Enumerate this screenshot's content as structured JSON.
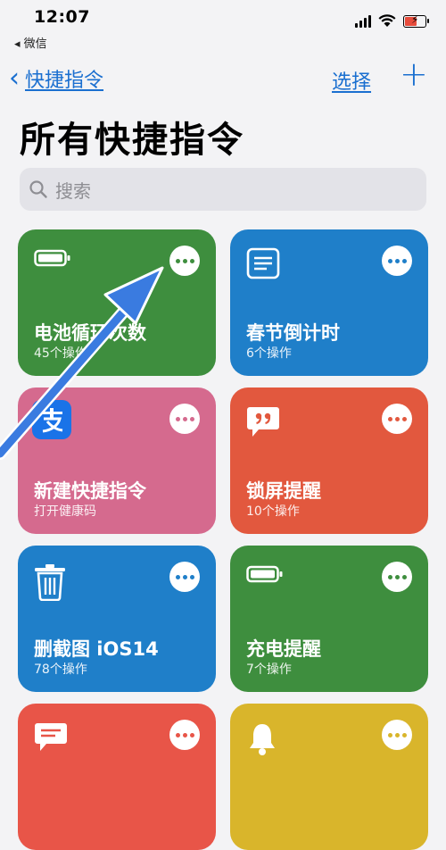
{
  "status": {
    "time": "12:07",
    "back_app": "◂ 微信"
  },
  "nav": {
    "back_label": "快捷指令",
    "select_label": "选择",
    "add_label": "+"
  },
  "page": {
    "title": "所有快捷指令"
  },
  "search": {
    "placeholder": "搜索"
  },
  "cards": [
    {
      "title": "电池循环次数",
      "subtitle": "45个操作",
      "icon": "battery-icon",
      "color": "#3e8e3e"
    },
    {
      "title": "春节倒计时",
      "subtitle": "6个操作",
      "icon": "document-icon",
      "color": "#1f7fc9"
    },
    {
      "title": "新建快捷指令",
      "subtitle": "打开健康码",
      "icon": "alipay-icon",
      "color": "#d56a8e"
    },
    {
      "title": "锁屏提醒",
      "subtitle": "10个操作",
      "icon": "quote-bubble-icon",
      "color": "#e2583e"
    },
    {
      "title": "删截图 iOS14",
      "subtitle": "78个操作",
      "icon": "trash-icon",
      "color": "#1f7fc9"
    },
    {
      "title": "充电提醒",
      "subtitle": "7个操作",
      "icon": "battery-icon",
      "color": "#3e8e3e"
    },
    {
      "title": "",
      "subtitle": "",
      "icon": "message-icon",
      "color": "#e85548"
    },
    {
      "title": "",
      "subtitle": "",
      "icon": "bell-icon",
      "color": "#d9b52b"
    }
  ],
  "colors": {
    "accent": "#1a6fd0",
    "arrow": "#3a7be0"
  }
}
